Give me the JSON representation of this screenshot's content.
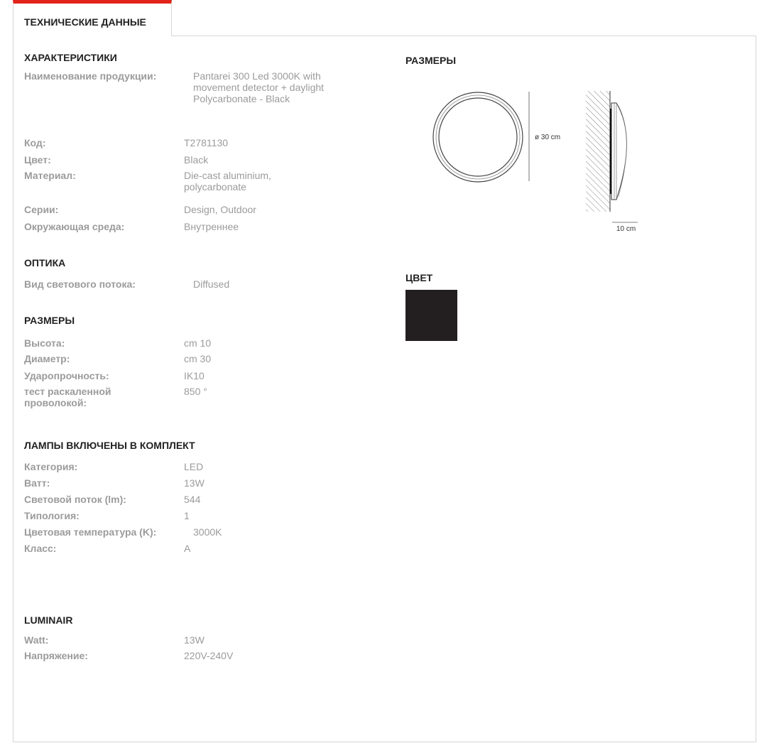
{
  "tab": {
    "label": "ТЕХНИЧЕСКИЕ ДАННЫЕ"
  },
  "sections": {
    "characteristics": {
      "title": "ХАРАКТЕРИСТИКИ",
      "rows": [
        {
          "label": "Наименование продукции:",
          "value": "Pantarei 300 Led 3000K with movement detector + daylight Polycarbonate - Black"
        },
        {
          "label": "Код:",
          "value": "T2781130"
        },
        {
          "label": "Цвет:",
          "value": "Black"
        },
        {
          "label": "Материал:",
          "value": "Die-cast aluminium, polycarbonate"
        },
        {
          "label": "Серии:",
          "value": "Design, Outdoor"
        },
        {
          "label": "Окружающая среда:",
          "value": "Внутреннее"
        }
      ]
    },
    "optics": {
      "title": "ОПТИКА",
      "rows": [
        {
          "label": "Вид светового потока:",
          "value": "Diffused"
        }
      ]
    },
    "dimensions": {
      "title": "РАЗМЕРЫ",
      "rows": [
        {
          "label": "Высота:",
          "value": "cm 10"
        },
        {
          "label": "Диаметр:",
          "value": "cm 30"
        },
        {
          "label": "Ударопрочность:",
          "value": "IK10"
        },
        {
          "label": "тест раскаленной проволокой:",
          "value": "850 °"
        }
      ]
    },
    "lamps": {
      "title": "ЛАМПЫ ВКЛЮЧЕНЫ В КОМПЛЕКТ",
      "rows": [
        {
          "label": "Категория:",
          "value": "LED"
        },
        {
          "label": "Ватт:",
          "value": "13W"
        },
        {
          "label": "Световой поток (lm):",
          "value": "544"
        },
        {
          "label": "Типология:",
          "value": "1"
        },
        {
          "label": "Цветовая температура (K):",
          "value": "3000K"
        },
        {
          "label": "Класс:",
          "value": "A"
        }
      ]
    },
    "luminair": {
      "title": "LUMINAIR",
      "rows": [
        {
          "label": "Watt:",
          "value": "13W"
        },
        {
          "label": "Напряжение:",
          "value": "220V-240V"
        }
      ]
    }
  },
  "right": {
    "dimensions_title": "РАЗМЕРЫ",
    "diagram_diameter_label": "ø 30 cm",
    "diagram_depth_label": "10 cm",
    "color_title": "ЦВЕТ",
    "swatch_color": "#231f20",
    "swatch_name": "black"
  },
  "colors": {
    "accent": "#e2231a",
    "label_gray": "#9b9b9b",
    "border": "#d6d6d6"
  }
}
